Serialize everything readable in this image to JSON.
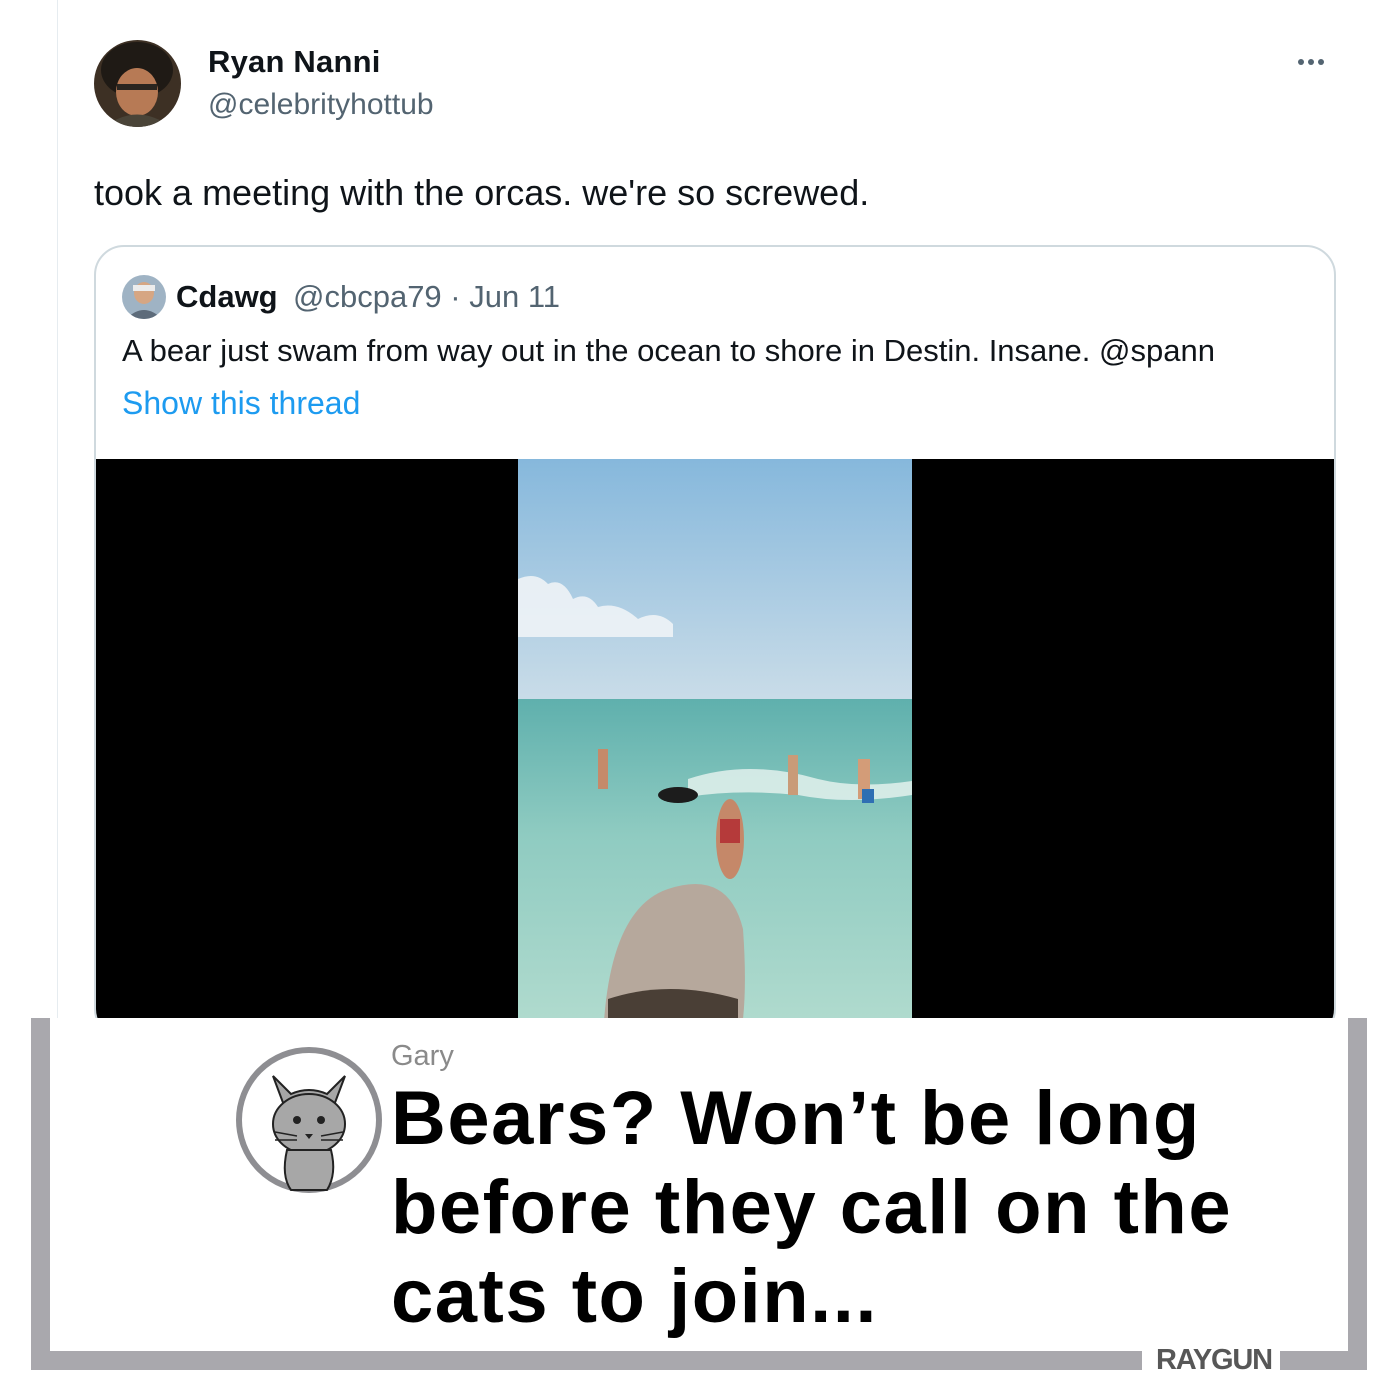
{
  "tweet": {
    "author_name": "Ryan Nanni",
    "author_handle": "@celebrityhottub",
    "text": "took a meeting with the orcas. we're so screwed.",
    "more_icon": "ellipsis-icon"
  },
  "quoted_tweet": {
    "author_name": "Cdawg",
    "handle_and_date": "@cbcpa79 · Jun 11",
    "text": "A bear just swam from way out in the ocean to shore in Destin. Insane. @spann",
    "show_thread": "Show this thread"
  },
  "caption": {
    "author": "Gary",
    "text": "Bears? Won’t be long before they call on the cats to join...",
    "brand": "RAYGUN"
  },
  "colors": {
    "link": "#1d9bf0",
    "secondary_text": "#536471",
    "frame": "#a9a8ad",
    "card_border": "#cfd9de"
  }
}
